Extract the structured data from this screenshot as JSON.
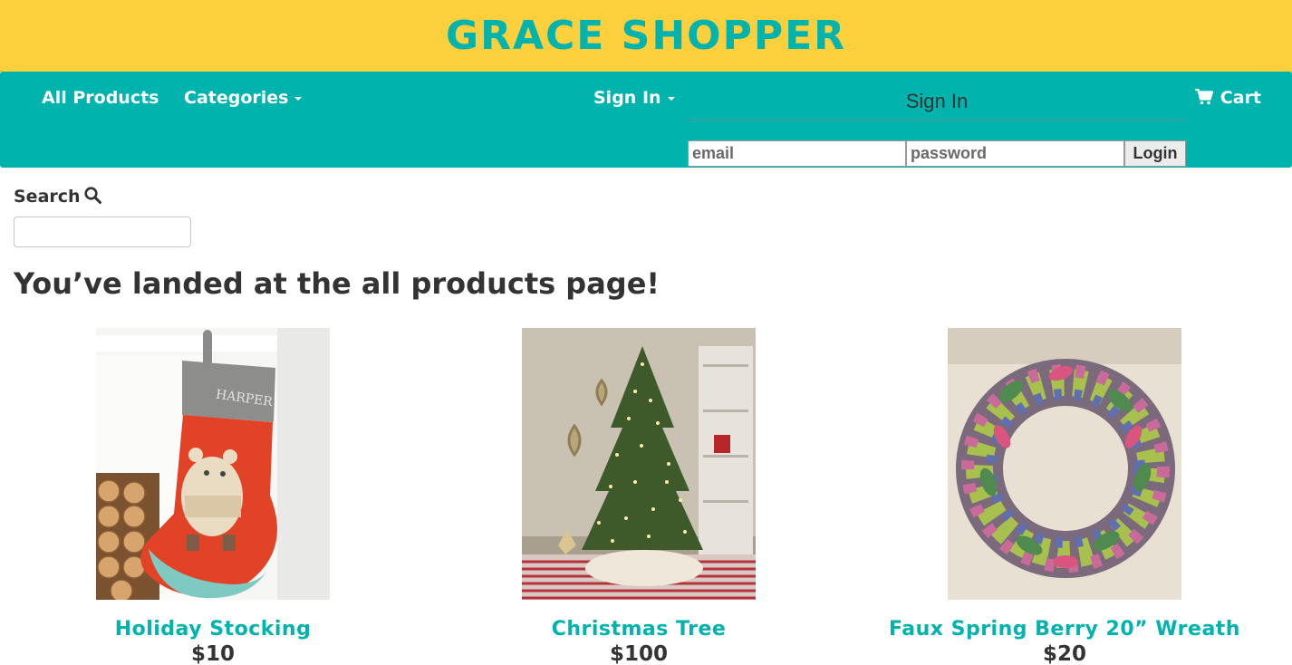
{
  "header": {
    "brand": "GRACE SHOPPER"
  },
  "nav": {
    "all_products": "All Products",
    "categories": "Categories",
    "sign_in": "Sign In",
    "cart": "Cart"
  },
  "signin_panel": {
    "title": "Sign In",
    "email_placeholder": "email",
    "password_placeholder": "password",
    "login_label": "Login"
  },
  "search": {
    "label": "Search",
    "value": ""
  },
  "heading": "You’ve landed at the all products page!",
  "products": [
    {
      "name": "Holiday Stocking",
      "price": "$10"
    },
    {
      "name": "Christmas Tree",
      "price": "$100"
    },
    {
      "name": "Faux Spring Berry 20” Wreath",
      "price": "$20"
    }
  ],
  "colors": {
    "banner": "#fccf3d",
    "accent": "#00b3ad",
    "text": "#333333"
  },
  "icons": {
    "cart": "shopping-cart-icon",
    "search": "magnifier-icon",
    "caret": "caret-down-icon"
  }
}
